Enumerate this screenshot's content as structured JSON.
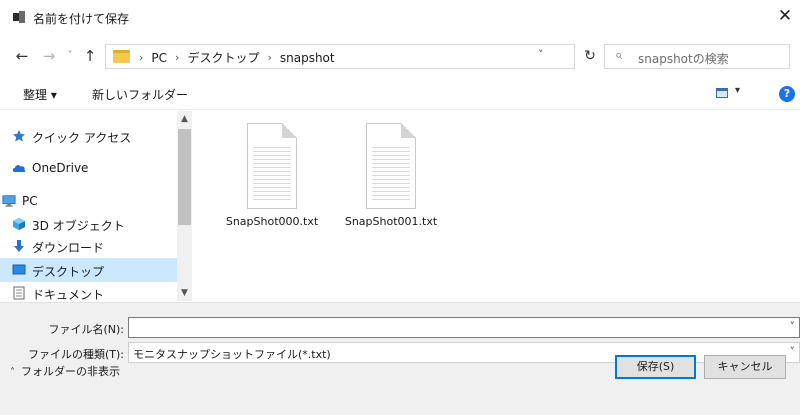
{
  "window": {
    "title": "名前を付けて保存",
    "close_label": "✕"
  },
  "nav": {
    "back": "←",
    "forward": "→",
    "recent": "˅",
    "up": "↑",
    "breadcrumbs": [
      "PC",
      "デスクトップ",
      "snapshot"
    ],
    "separator": "›",
    "address_dropdown": "˅",
    "refresh": "↻",
    "search_placeholder": "snapshotの検索",
    "search_icon": "⌕"
  },
  "toolbar": {
    "organize": "整理 ▾",
    "new_folder": "新しいフォルダー",
    "view_drop": "▾",
    "help": "?"
  },
  "sidebar": {
    "items": [
      {
        "label": "クイック アクセス",
        "icon": "star-icon"
      },
      {
        "label": "OneDrive",
        "icon": "cloud-icon"
      },
      {
        "label": "PC",
        "icon": "computer-icon"
      },
      {
        "label": "3D オブジェクト",
        "icon": "cube-icon"
      },
      {
        "label": "ダウンロード",
        "icon": "download-arrow-icon"
      },
      {
        "label": "デスクトップ",
        "icon": "desktop-icon",
        "selected": true
      },
      {
        "label": "ドキュメント",
        "icon": "document-icon"
      }
    ],
    "scroll_up": "▲",
    "scroll_down": "▼"
  },
  "files": [
    {
      "name": "SnapShot000.txt"
    },
    {
      "name": "SnapShot001.txt"
    }
  ],
  "form": {
    "filename_label": "ファイル名(N):",
    "filename_value": "",
    "filetype_label": "ファイルの種類(T):",
    "filetype_value": "モニタスナップショットファイル(*.txt)",
    "dropdown": "˅"
  },
  "footer": {
    "hide_folders_chevron": "˄",
    "hide_folders": "フォルダーの非表示",
    "save": "保存(S)",
    "cancel": "キャンセル"
  },
  "colors": {
    "accent": "#0078d7",
    "selected": "#cce8ff",
    "folder": "#f5c94b",
    "help": "#1a73e8"
  }
}
